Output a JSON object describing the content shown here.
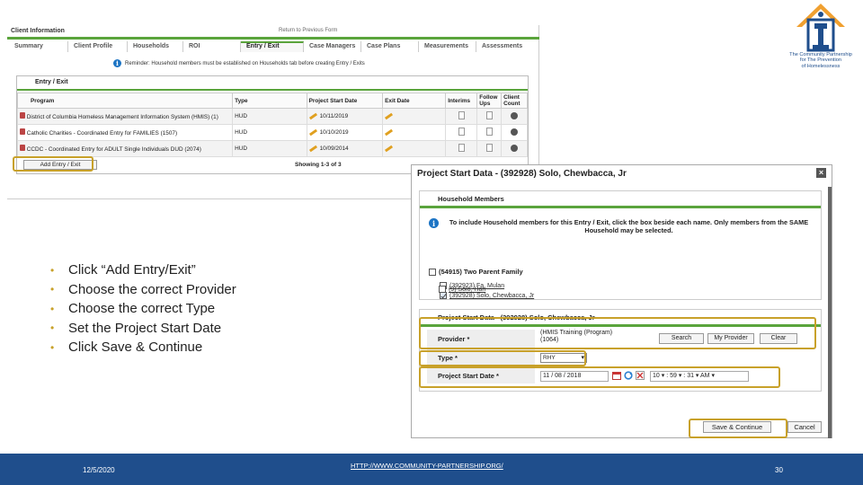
{
  "client_info": {
    "title": "Client Information",
    "top_link": "Return to Previous Form",
    "tabs": [
      "Summary",
      "Client Profile",
      "Households",
      "ROI",
      "Entry / Exit",
      "Case Managers",
      "Case Plans",
      "Measurements",
      "Assessments"
    ],
    "active_tab": "Entry / Exit",
    "notice": "Reminder: Household members must be established on Households tab before creating Entry / Exits",
    "panel_title": "Entry / Exit",
    "columns": [
      "Program",
      "Type",
      "Project Start Date",
      "Exit Date",
      "Interims",
      "Follow Ups",
      "Client Count"
    ],
    "rows": [
      {
        "program": "District of Columbia Homeless Management Information System (HMIS) (1)",
        "type": "HUD",
        "start_date": "10/11/2019"
      },
      {
        "program": "Catholic Charities - Coordinated Entry for FAMILIES (1507)",
        "type": "HUD",
        "start_date": "10/10/2019"
      },
      {
        "program": "CCDC - Coordinated Entry for ADULT Single Individuals DUD (2074)",
        "type": "HUD",
        "start_date": "10/09/2014"
      }
    ],
    "add_button": "Add Entry / Exit",
    "showing": "Showing 1-3 of 3"
  },
  "logo": {
    "lines": [
      "The Community Partnership",
      "for The Prevention",
      "of Homelessness"
    ],
    "brand_color": "#1f4e8c",
    "accent_color": "#f0a030"
  },
  "bullets": [
    "Click “Add Entry/Exit”",
    "Choose the correct Provider",
    "Choose the correct Type",
    "Set the Project Start Date",
    "Click Save & Continue"
  ],
  "dialog": {
    "title": "Project Start Data - (392928) Solo, Chewbacca, Jr",
    "household_title": "Household Members",
    "household_info": "To include Household members for this Entry / Exit, click the box beside each name. Only members from the SAME Household may be selected.",
    "family": "(54915) Two Parent Family",
    "members": [
      {
        "label": "(392923) Fa, Mulan",
        "checked": false
      },
      {
        "label": "(392928) Solo, Chewbacca, Jr",
        "checked": true
      },
      {
        "label": "(9) Solo, Han",
        "checked": false
      }
    ],
    "psd_title": "Project Start Data - (392928) Solo, Chewbacca, Jr",
    "provider_label": "Provider *",
    "provider_value_line1": "(HMIS Training (Program)",
    "provider_value_line2": "(1064)",
    "search_button": "Search",
    "my_provider_button": "My Provider",
    "clear_button": "Clear",
    "type_label": "Type *",
    "type_value": "RHY",
    "start_label": "Project Start Date *",
    "start_month": "11",
    "start_day": "08",
    "start_year": "2018",
    "start_hour": "10",
    "start_minute": "59",
    "start_second": "31",
    "start_ampm": "AM",
    "save_button": "Save & Continue",
    "cancel_button": "Cancel"
  },
  "footer": {
    "date": "12/5/2020",
    "url": "HTTP://WWW.COMMUNITY-PARTNERSHIP.ORG/",
    "page": "30",
    "bar_color": "#1f4e8c"
  },
  "colors": {
    "highlight": "#c8a12a",
    "green_bar": "#5aa43c"
  }
}
